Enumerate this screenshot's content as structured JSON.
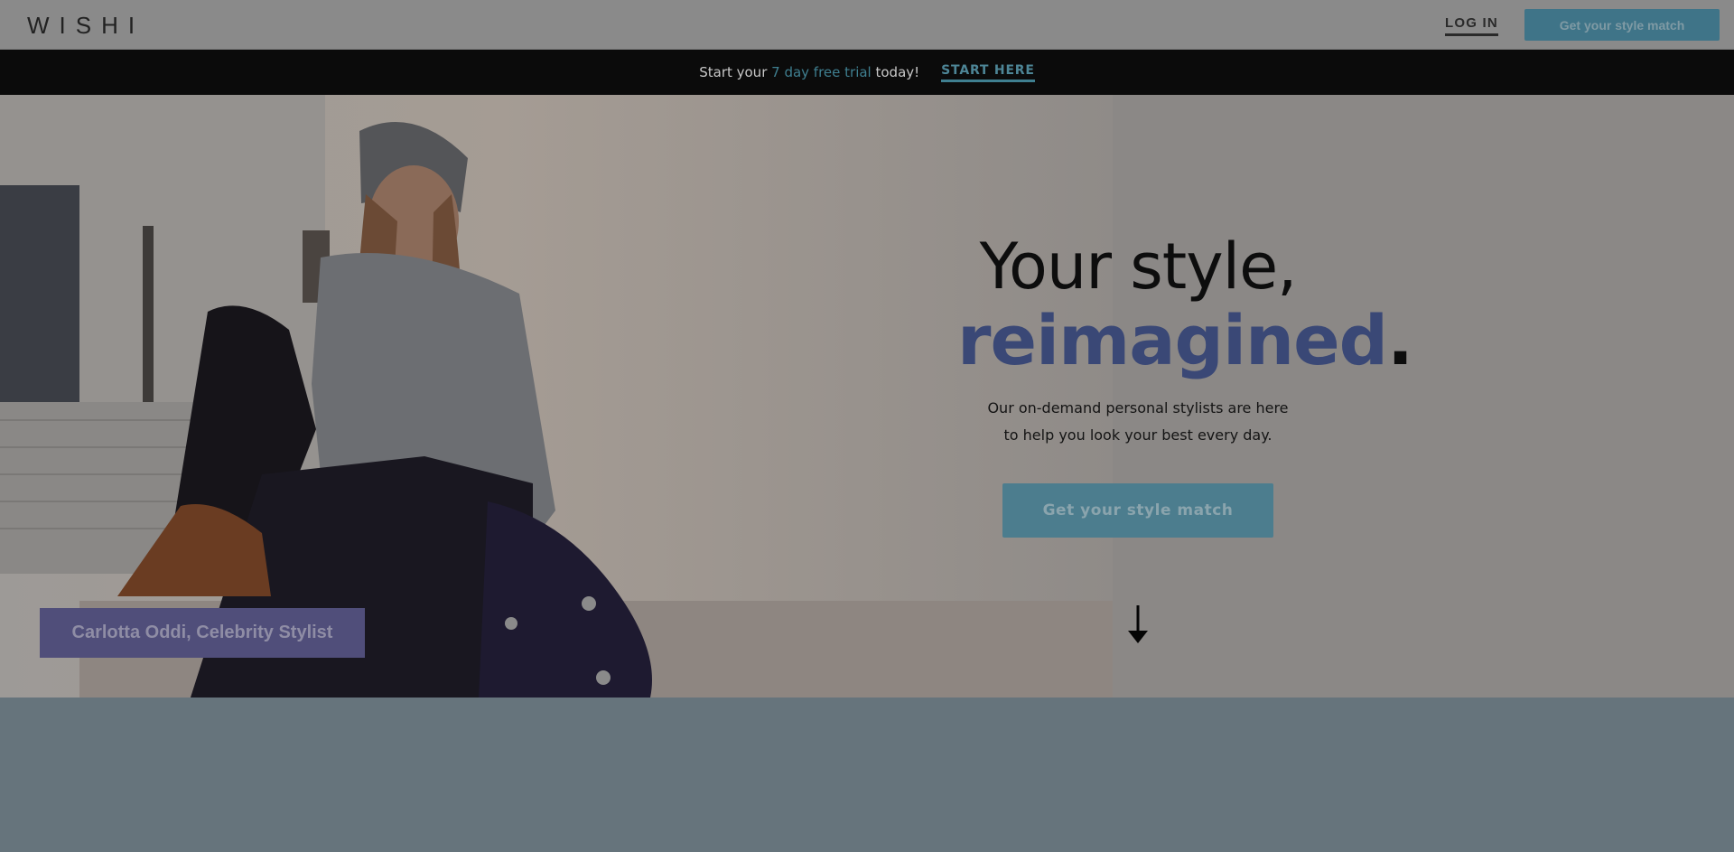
{
  "header": {
    "logo": "WISHI",
    "login": "LOG IN",
    "cta": "Get your style match"
  },
  "promo": {
    "prefix": "Start your ",
    "highlight": "7 day free trial",
    "suffix": " today!",
    "link": "START HERE"
  },
  "hero": {
    "title_line1": "Your style,",
    "title_line2": "reimagined",
    "title_period": ".",
    "subtitle_line1": "Our on-demand personal stylists are here",
    "subtitle_line2": "to help you look your best every day.",
    "cta": "Get your style match",
    "caption": "Carlotta Oddi, Celebrity Stylist",
    "scroll_icon": "arrow-down-icon"
  },
  "colors": {
    "accent": "#4c7d8e",
    "brand_blue": "#3a4876",
    "promo_bg": "#0b0b0b"
  }
}
